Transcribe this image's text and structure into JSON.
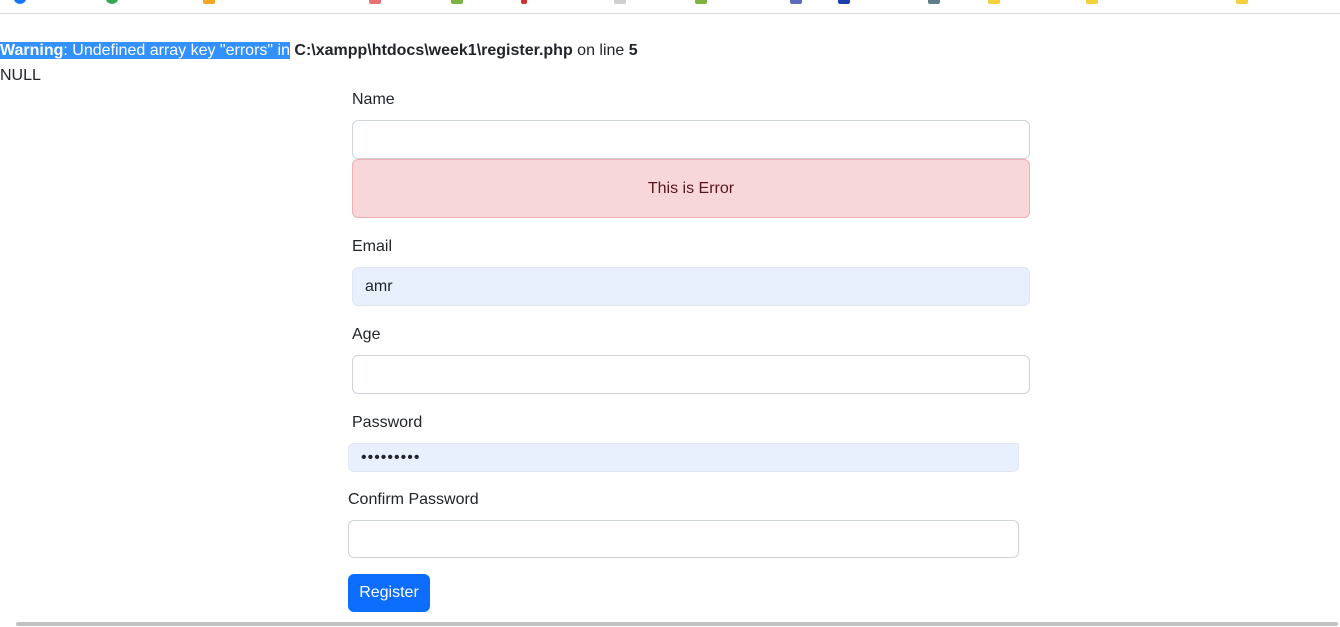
{
  "php_warning": {
    "label": "Warning",
    "message": ": Undefined array key \"errors\" in",
    "file": "C:\\xampp\\htdocs\\week1\\register.php",
    "on_line": "on line",
    "line": "5"
  },
  "var_dump": "NULL",
  "form": {
    "name": {
      "label": "Name",
      "value": ""
    },
    "error_alert": "This is Error",
    "email": {
      "label": "Email",
      "value": "amr"
    },
    "age": {
      "label": "Age",
      "value": ""
    },
    "password": {
      "label": "Password",
      "value": "•••••••••"
    },
    "confirm_password": {
      "label": "Confirm Password",
      "value": ""
    },
    "submit_label": "Register"
  },
  "colors": {
    "primary": "#0d6efd",
    "alert_bg": "#f8d7da",
    "alert_text": "#58151c",
    "autofill_bg": "#e8f0fe",
    "selection": "#3390ff"
  }
}
